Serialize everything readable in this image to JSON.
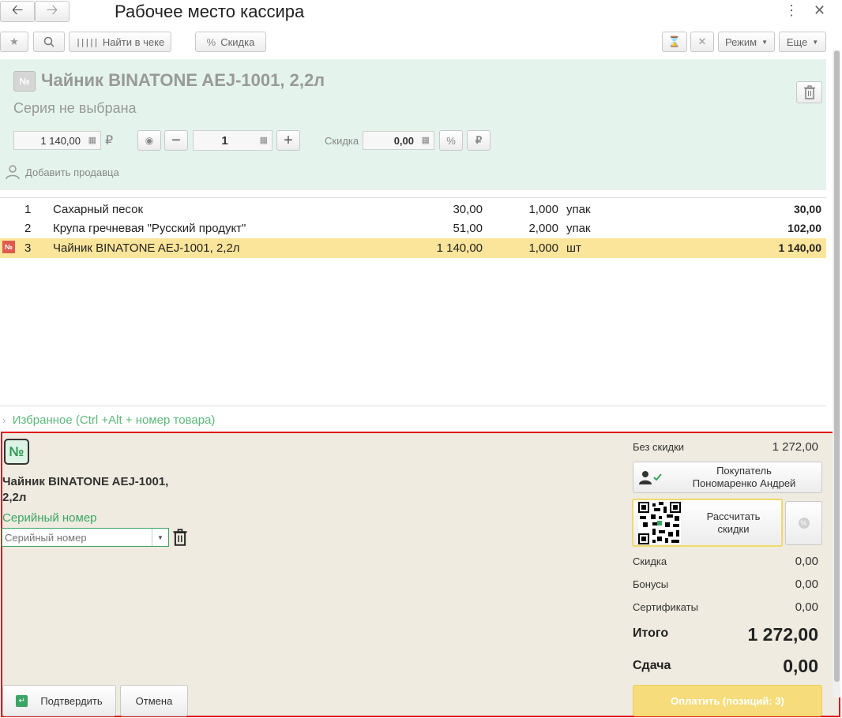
{
  "window": {
    "title": "Рабочее место кассира"
  },
  "toolbar": {
    "find_in_receipt": "Найти в чеке",
    "discount": "Скидка",
    "mode": "Режим",
    "more": "Еще"
  },
  "current_item": {
    "name": "Чайник BINATONE  AEJ-1001,  2,2л",
    "series": "Серия не выбрана",
    "price": "1 140,00",
    "currency": "₽",
    "quantity": "1",
    "discount_label": "Скидка",
    "discount_value": "0,00",
    "add_seller": "Добавить продавца"
  },
  "receipt": {
    "rows": [
      {
        "num": "1",
        "name": "Сахарный песок",
        "price": "30,00",
        "qty": "1,000",
        "unit": "упак",
        "sum": "30,00"
      },
      {
        "num": "2",
        "name": "Крупа гречневая \"Русский продукт\"",
        "price": "51,00",
        "qty": "2,000",
        "unit": "упак",
        "sum": "102,00"
      },
      {
        "num": "3",
        "name": "Чайник BINATONE  AEJ-1001,  2,2л",
        "price": "1 140,00",
        "qty": "1,000",
        "unit": "шт",
        "sum": "1 140,00"
      }
    ]
  },
  "favorites": "Избранное (Ctrl +Alt + номер товара)",
  "serial_panel": {
    "badge": "№",
    "item_name_line1": "Чайник BINATONE  AEJ-1001,",
    "item_name_line2": "2,2л",
    "serial_label": "Серийный номер",
    "serial_placeholder": "Серийный номер",
    "confirm": "Подтвердить",
    "cancel": "Отмена"
  },
  "summary": {
    "without_discount_label": "Без скидки",
    "without_discount_value": "1 272,00",
    "buyer_line1": "Покупатель",
    "buyer_line2": "Пономаренко Андрей",
    "calc_line1": "Рассчитать",
    "calc_line2": "скидки",
    "discount_label": "Скидка",
    "discount_value": "0,00",
    "bonuses_label": "Бонусы",
    "bonuses_value": "0,00",
    "certificates_label": "Сертификаты",
    "certificates_value": "0,00",
    "total_label": "Итого",
    "total_value": "1 272,00",
    "change_label": "Сдача",
    "change_value": "0,00",
    "pay_button": "Оплатить (позиций: 3)"
  },
  "colors": {
    "accent_green": "#3aa564",
    "highlight_row": "#fbe59a",
    "panel_green": "#e4f4ec",
    "bottom_panel": "#efebe0",
    "pay_button": "#f6dc7a",
    "red_border": "#e01515"
  }
}
